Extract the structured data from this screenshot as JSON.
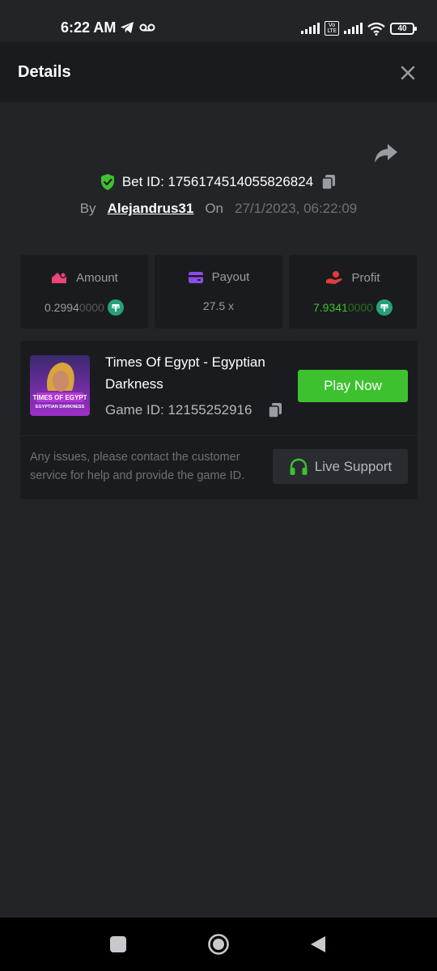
{
  "status_bar": {
    "time": "6:22 AM",
    "battery": "40",
    "volte_line1": "Vo",
    "volte_line2": "LTE"
  },
  "header": {
    "title": "Details"
  },
  "bet": {
    "bet_id": "Bet ID: 1756174514055826824",
    "by_label": "By",
    "username": "Alejandrus31",
    "on_label": "On",
    "date": "27/1/2023, 06:22:09"
  },
  "stats": {
    "amount": {
      "label": "Amount",
      "value_main": "0.2994",
      "value_dim": "0000"
    },
    "payout": {
      "label": "Payout",
      "value": "27.5 x"
    },
    "profit": {
      "label": "Profit",
      "value_main": "7.9341",
      "value_dim": "0000"
    }
  },
  "game": {
    "title": "Times Of Egypt - Egyptian Darkness",
    "game_id": "Game ID: 12155252916",
    "thumb_line1": "TIMES OF EGYPT",
    "thumb_line2": "EGYPTIAN DARKNESS",
    "play_label": "Play Now"
  },
  "support": {
    "note": "Any issues, please contact the customer service for help and provide the game ID.",
    "button_label": "Live Support"
  },
  "colors": {
    "background": "#232428",
    "panel": "#1a1b1e",
    "accent_green": "#3dc12f",
    "tether": "#26a17b"
  }
}
